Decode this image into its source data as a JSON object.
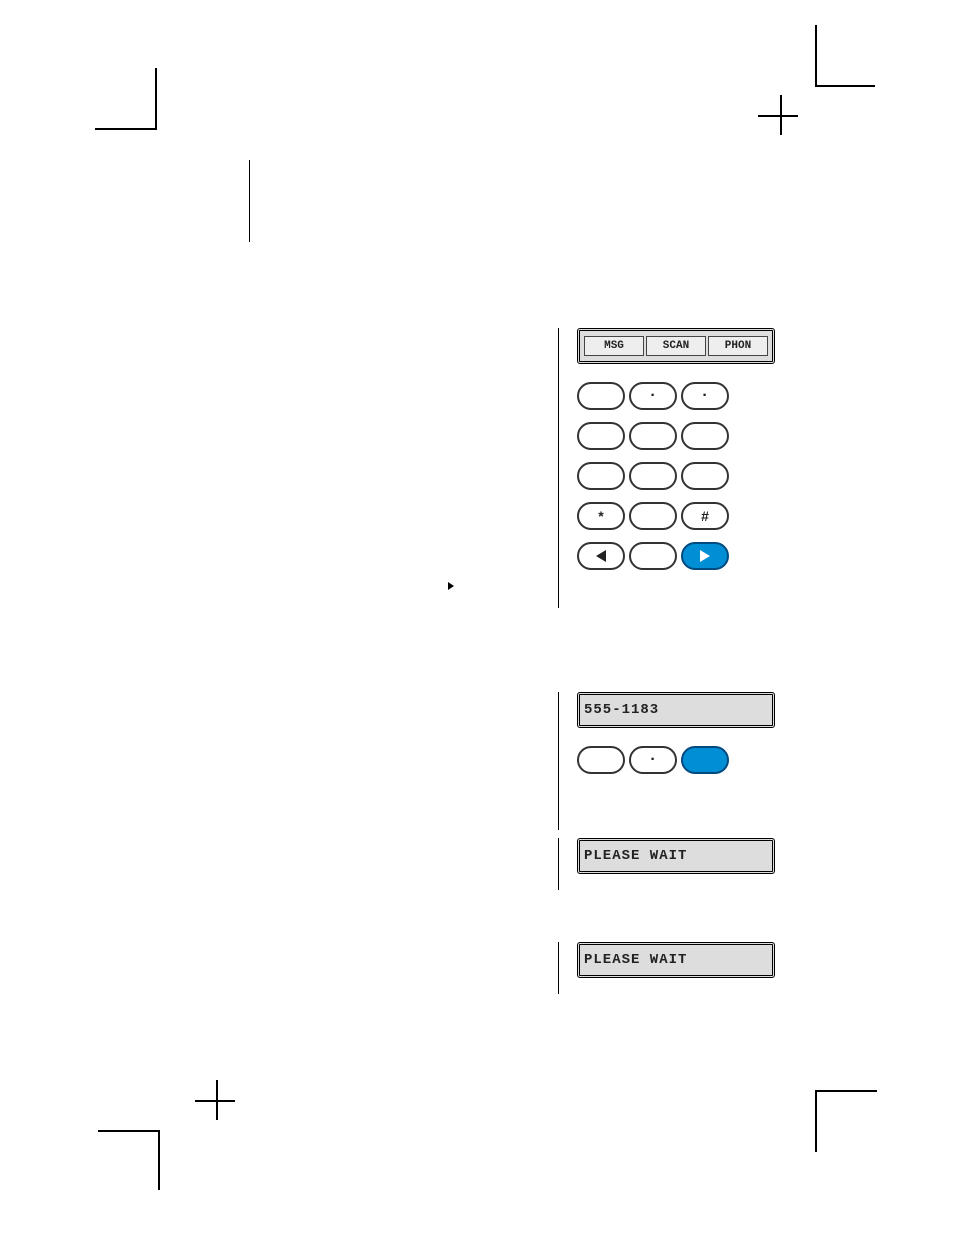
{
  "lcd_tabs": {
    "msg": "MSG",
    "scan": "SCAN",
    "phon": "PHON"
  },
  "lcd_number": "555-1183",
  "lcd_wait": "PLEASE WAIT",
  "keypad": {
    "star": "*",
    "hash": "#"
  }
}
